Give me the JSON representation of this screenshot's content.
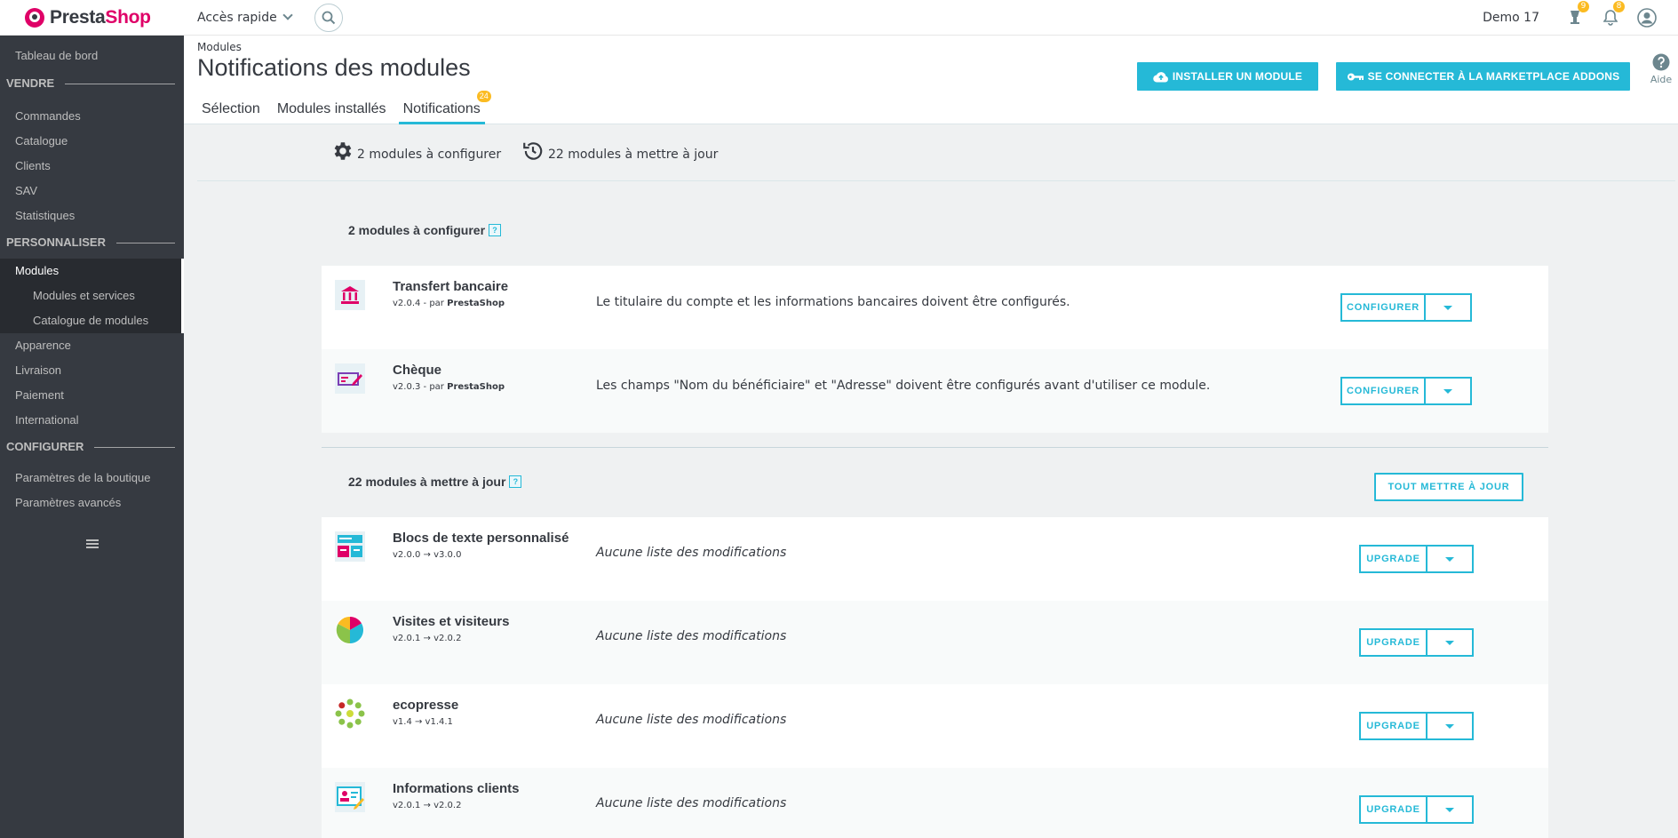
{
  "header": {
    "logo_part1": "Presta",
    "logo_part2": "Shop",
    "quick_access": "Accès rapide",
    "shop_name": "Demo 17",
    "orders_badge": "9",
    "notifications_badge": "8"
  },
  "sidebar": {
    "dashboard": "Tableau de bord",
    "sections": {
      "sell": "VENDRE",
      "customize": "PERSONNALISER",
      "configure": "CONFIGURER"
    },
    "sell_items": [
      "Commandes",
      "Catalogue",
      "Clients",
      "SAV",
      "Statistiques"
    ],
    "modules": "Modules",
    "modules_sub": [
      "Modules et services",
      "Catalogue de modules"
    ],
    "customize_items": [
      "Apparence",
      "Livraison",
      "Paiement",
      "International"
    ],
    "configure_items": [
      "Paramètres de la boutique",
      "Paramètres avancés"
    ]
  },
  "page": {
    "breadcrumb": "Modules",
    "title": "Notifications des modules",
    "tabs": [
      {
        "label": "Sélection"
      },
      {
        "label": "Modules installés"
      },
      {
        "label": "Notifications",
        "badge": "24"
      }
    ],
    "install_button": "Installer un module",
    "connect_button": "Se connecter à la Marketplace Addons",
    "help": "Aide"
  },
  "summary": {
    "to_configure": "2 modules à configurer",
    "to_update": "22 modules à mettre à jour"
  },
  "configure_section": {
    "title": "2 modules à configurer",
    "help": "?",
    "modules": [
      {
        "name": "Transfert bancaire",
        "version": "v2.0.4 - par",
        "author": "PrestaShop",
        "description": "Le titulaire du compte et les informations bancaires doivent être configurés.",
        "button": "Configurer"
      },
      {
        "name": "Chèque",
        "version": "v2.0.3 - par",
        "author": "PrestaShop",
        "description": "Les champs \"Nom du bénéficiaire\" et \"Adresse\" doivent être configurés avant d'utiliser ce module.",
        "button": "Configurer"
      }
    ]
  },
  "update_section": {
    "title": "22 modules à mettre à jour",
    "help": "?",
    "update_all": "Tout mettre à jour",
    "modules": [
      {
        "name": "Blocs de texte personnalisé",
        "version": "v2.0.0 → v3.0.0",
        "description": "Aucune liste des modifications",
        "button": "Upgrade"
      },
      {
        "name": "Visites et visiteurs",
        "version": "v2.0.1 → v2.0.2",
        "description": "Aucune liste des modifications",
        "button": "Upgrade"
      },
      {
        "name": "ecopresse",
        "version": "v1.4 → v1.4.1",
        "description": "Aucune liste des modifications",
        "button": "Upgrade"
      },
      {
        "name": "Informations clients",
        "version": "v2.0.1 → v2.0.2",
        "description": "Aucune liste des modifications",
        "button": "Upgrade"
      }
    ]
  },
  "colors": {
    "accent": "#25b9d7",
    "badge": "#fbbb22",
    "brand_pink": "#df0067",
    "sidebar_bg": "#363a41"
  }
}
